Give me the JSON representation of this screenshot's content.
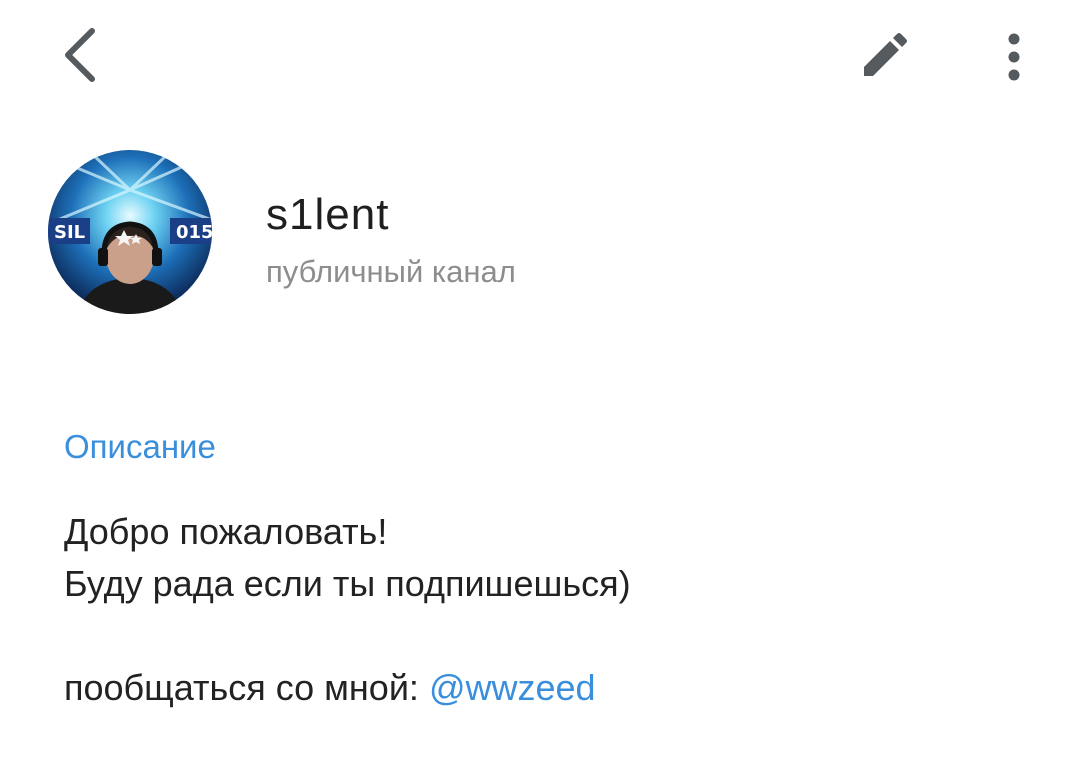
{
  "toolbar": {
    "back_icon": "chevron-left-icon",
    "edit_icon": "pencil-icon",
    "more_icon": "more-vertical-icon",
    "icon_color": "#555a5f"
  },
  "channel": {
    "name": "s1lent",
    "type": "публичный канал"
  },
  "description": {
    "header": "Описание",
    "line1": "Добро пожаловать!",
    "line2": "Буду рада если ты подпишешься)",
    "contact_prefix": "пообщаться со мной: ",
    "contact_handle": "@wwzeed"
  },
  "colors": {
    "accent": "#3a8fdc",
    "secondary_text": "#8d8d8d",
    "primary_text": "#222222"
  }
}
